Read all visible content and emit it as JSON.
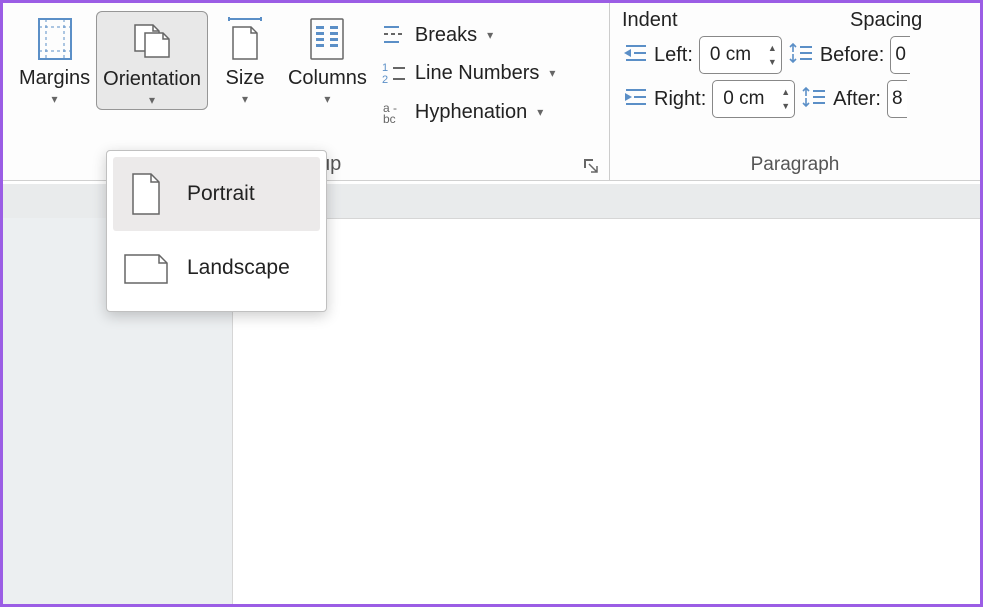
{
  "ribbon": {
    "page_setup": {
      "margins": "Margins",
      "orientation": "Orientation",
      "size": "Size",
      "columns": "Columns",
      "breaks": "Breaks",
      "line_numbers": "Line Numbers",
      "hyphenation": "Hyphenation",
      "section_label_partial": "up"
    },
    "paragraph": {
      "indent_header": "Indent",
      "spacing_header": "Spacing",
      "left_label": "Left:",
      "right_label": "Right:",
      "before_label": "Before:",
      "after_label": "After:",
      "left_value": "0 cm",
      "right_value": "0 cm",
      "before_value": "0",
      "after_value": "8",
      "section_label": "Paragraph"
    }
  },
  "dropdown": {
    "portrait": "Portrait",
    "landscape": "Landscape"
  }
}
